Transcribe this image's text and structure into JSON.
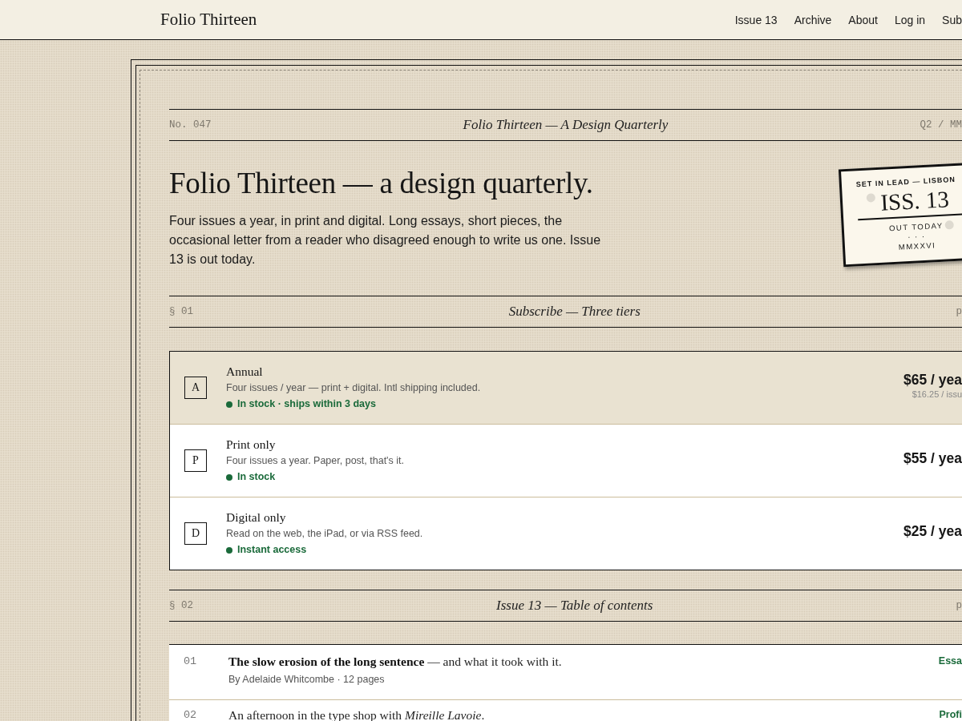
{
  "nav": {
    "logo": "Folio Thirteen",
    "links": [
      "Issue 13",
      "Archive",
      "About",
      "Log in",
      "Sub"
    ]
  },
  "masthead": {
    "number": "No. 047",
    "title": "Folio Thirteen — A Design Quarterly",
    "date": "Q2 / MM"
  },
  "intro": {
    "heading": "Folio Thirteen — a design quarterly.",
    "body": "Four issues a year, in print and digital. Long essays, short pieces, the occasional letter from a reader who disagreed enough to write us one. Issue 13 is out today."
  },
  "stamp": {
    "top_line": "SET IN LEAD — LISBON",
    "issue": "ISS. 13",
    "status": "OUT TODAY",
    "separator": "· · ·",
    "year": "MMXXVI"
  },
  "subscribe": {
    "section": {
      "number": "§ 01",
      "title": "Subscribe — Three tiers",
      "aside": "p"
    },
    "tiers": [
      {
        "letter": "A",
        "name": "Annual",
        "description": "Four issues / year — print + digital. Intl shipping included.",
        "availability": "In stock · ships within 3 days",
        "price": "$65 / yea",
        "per_issue": "$16.25 / issu",
        "selected": true
      },
      {
        "letter": "P",
        "name": "Print only",
        "description": "Four issues a year. Paper, post, that's it.",
        "availability": "In stock",
        "price": "$55 / yea",
        "selected": false
      },
      {
        "letter": "D",
        "name": "Digital only",
        "description": "Read on the web, the iPad, or via RSS feed.",
        "availability": "Instant access",
        "price": "$25 / yea",
        "selected": false
      }
    ]
  },
  "contents": {
    "section": {
      "number": "§ 02",
      "title": "Issue 13 — Table of contents",
      "aside": "p"
    },
    "articles": [
      {
        "number": "01",
        "title": "**The slow erosion of the long sentence** — and what it took with it.",
        "byline": "By Adelaide Whitcombe · 12 pages",
        "category": "Essa"
      },
      {
        "number": "02",
        "title": "An afternoon in the type shop with *Mireille Lavoie*.",
        "category": "Profi"
      }
    ]
  }
}
